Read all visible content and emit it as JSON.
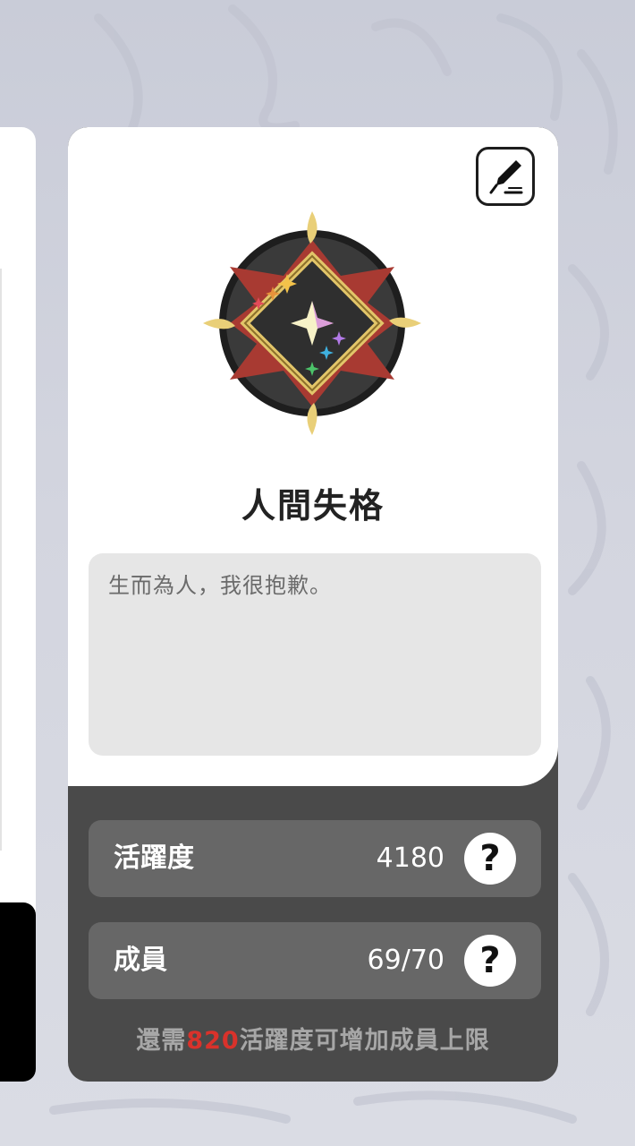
{
  "guild": {
    "name": "人間失格",
    "motto": "生而為人，我很抱歉。"
  },
  "stats": {
    "activity": {
      "label": "活躍度",
      "value": "4180"
    },
    "members": {
      "label": "成員",
      "value": "69/70"
    }
  },
  "help_icon_glyph": "?",
  "footer": {
    "prefix": "還需",
    "amount": "820",
    "suffix": "活躍度可增加成員上限"
  },
  "icons": {
    "edit": "edit-pen-icon",
    "emblem": "guild-emblem-icon",
    "help": "question-mark-icon"
  },
  "colors": {
    "card_top": "#ffffff",
    "card_bottom": "#4a4a4a",
    "stat_row": "#676767",
    "highlight": "#d9322b"
  }
}
